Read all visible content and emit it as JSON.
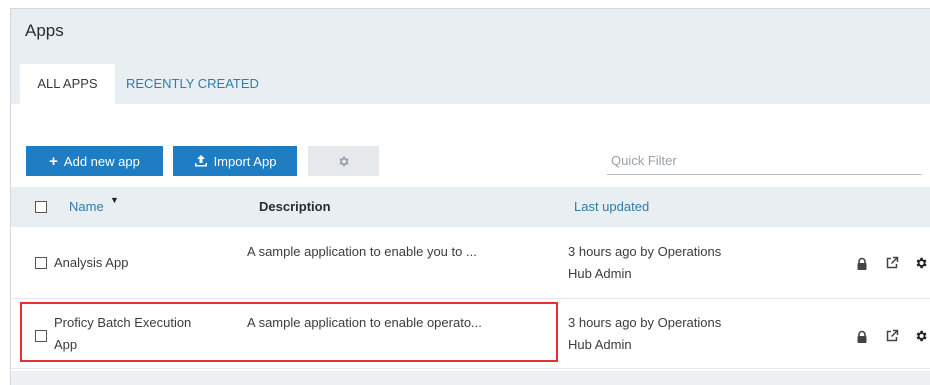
{
  "header": {
    "title": "Apps",
    "tabs": [
      {
        "label": "ALL APPS",
        "active": true
      },
      {
        "label": "RECENTLY CREATED",
        "active": false
      }
    ]
  },
  "toolbar": {
    "add_label": "Add new app",
    "import_label": "Import App",
    "settings_icon": "gear-icon",
    "filter_placeholder": "Quick Filter"
  },
  "table": {
    "columns": {
      "name": "Name",
      "description": "Description",
      "last_updated": "Last updated"
    },
    "rows": [
      {
        "name": "Analysis App",
        "description": "A sample application to enable you to ...",
        "updated_line1": "3 hours ago by Operations",
        "updated_line2": "Hub Admin",
        "actions": [
          "lock-icon",
          "external-link-icon",
          "gear-icon"
        ]
      },
      {
        "name_line1": "Proficy Batch Execution",
        "name_line2": "App",
        "description": "A sample application to enable operato...",
        "updated_line1": "3 hours ago by Operations",
        "updated_line2": "Hub Admin",
        "actions": [
          "lock-icon",
          "external-link-icon",
          "gear-icon"
        ],
        "highlighted": true
      }
    ]
  },
  "colors": {
    "accent": "#1f7dc3",
    "link": "#2e7ea8",
    "header_bg": "#e9eef2",
    "highlight": "#e5312f"
  }
}
